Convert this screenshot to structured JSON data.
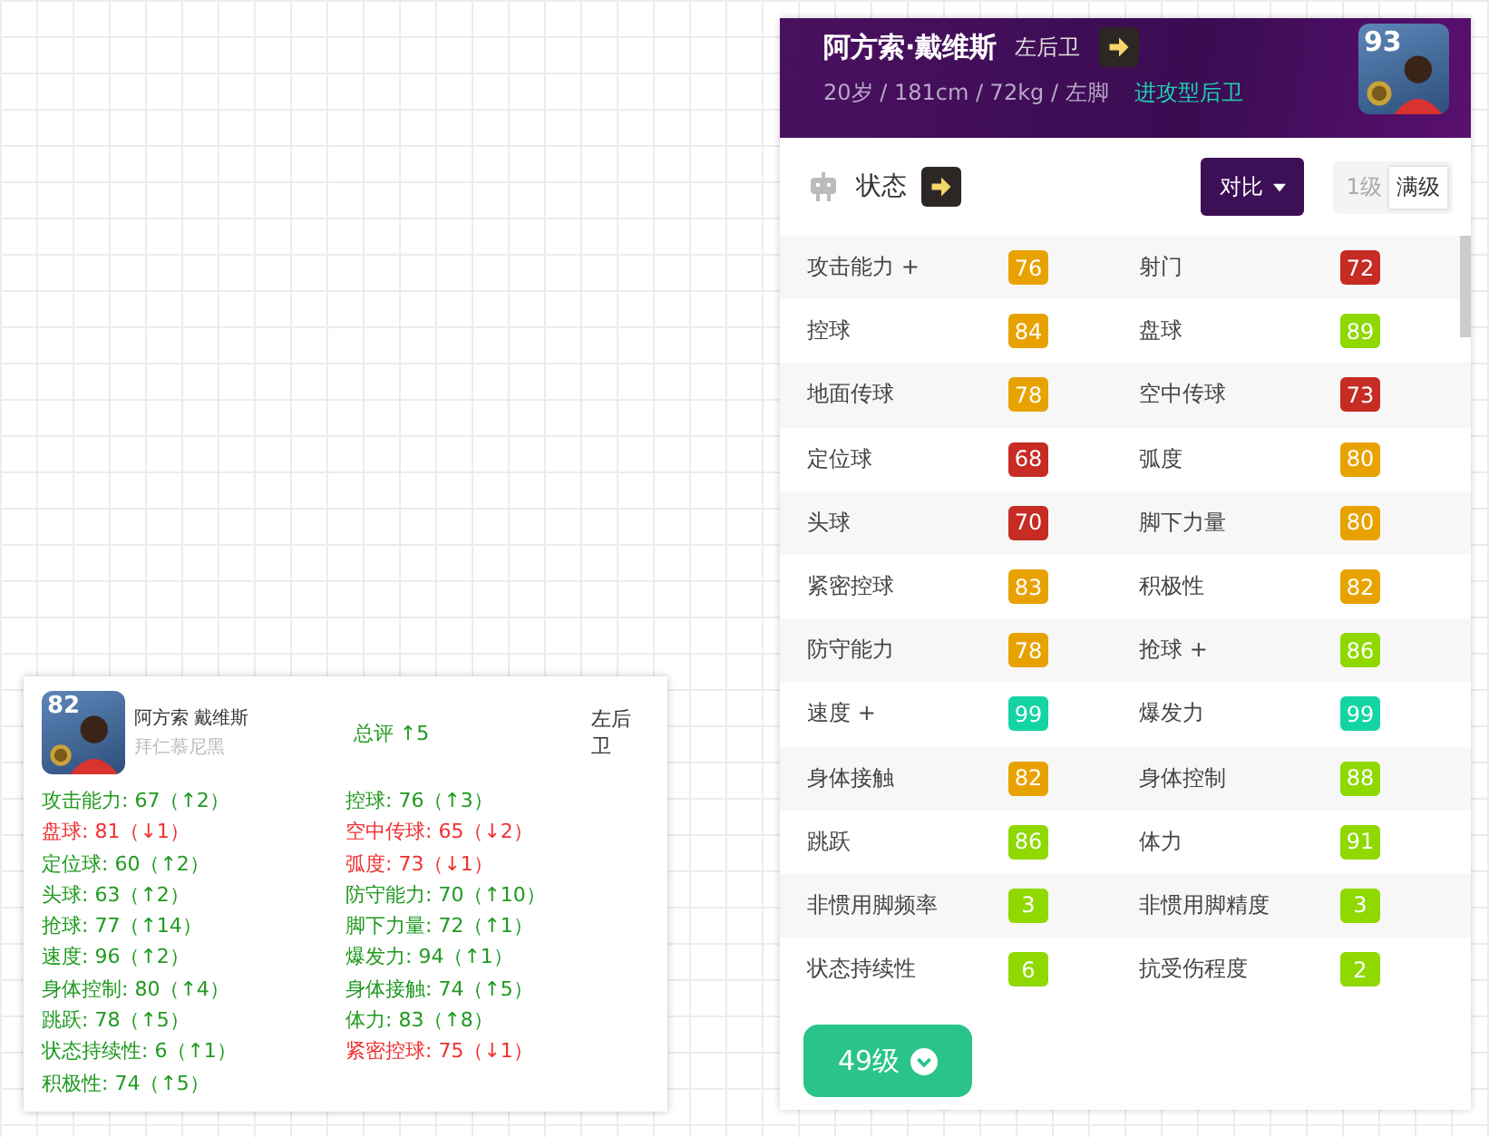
{
  "player_panel": {
    "name": "阿方索·戴维斯",
    "position": "左后卫",
    "rating": "93",
    "bio": "20岁 / 181cm / 72kg / 左脚",
    "role": "进攻型后卫",
    "section_title": "状态",
    "compare_button": "对比",
    "levels": [
      {
        "label": "1级",
        "selected": false
      },
      {
        "label": "满级",
        "selected": true
      }
    ],
    "stats": [
      {
        "label": "攻击能力 +",
        "value": "76",
        "color": "#e8a200"
      },
      {
        "label": "射门",
        "value": "72",
        "color": "#c62b24"
      },
      {
        "label": "控球",
        "value": "84",
        "color": "#e8a200"
      },
      {
        "label": "盘球",
        "value": "89",
        "color": "#8fd800"
      },
      {
        "label": "地面传球",
        "value": "78",
        "color": "#e8a200"
      },
      {
        "label": "空中传球",
        "value": "73",
        "color": "#c62b24"
      },
      {
        "label": "定位球",
        "value": "68",
        "color": "#c62b24"
      },
      {
        "label": "弧度",
        "value": "80",
        "color": "#e8a200"
      },
      {
        "label": "头球",
        "value": "70",
        "color": "#c62b24"
      },
      {
        "label": "脚下力量",
        "value": "80",
        "color": "#e8a200"
      },
      {
        "label": "紧密控球",
        "value": "83",
        "color": "#e8a200"
      },
      {
        "label": "积极性",
        "value": "82",
        "color": "#e8a200"
      },
      {
        "label": "防守能力",
        "value": "78",
        "color": "#e8a200"
      },
      {
        "label": "抢球 +",
        "value": "86",
        "color": "#8fd800"
      },
      {
        "label": "速度 +",
        "value": "99",
        "color": "#14d4a4"
      },
      {
        "label": "爆发力",
        "value": "99",
        "color": "#14d4a4"
      },
      {
        "label": "身体接触",
        "value": "82",
        "color": "#e8a200"
      },
      {
        "label": "身体控制",
        "value": "88",
        "color": "#8fd800"
      },
      {
        "label": "跳跃",
        "value": "86",
        "color": "#8fd800"
      },
      {
        "label": "体力",
        "value": "91",
        "color": "#8fd800"
      },
      {
        "label": "非惯用脚频率",
        "value": "3",
        "color": "#8fd800"
      },
      {
        "label": "非惯用脚精度",
        "value": "3",
        "color": "#8fd800"
      },
      {
        "label": "状态持续性",
        "value": "6",
        "color": "#8fd800"
      },
      {
        "label": "抗受伤程度",
        "value": "2",
        "color": "#8fd800"
      }
    ],
    "level_button": "49级"
  },
  "compare_card": {
    "rating": "82",
    "name": "阿方索 戴维斯",
    "club": "拜仁慕尼黑",
    "overall": "总评 ↑5",
    "position": "左后卫",
    "left_changes": [
      {
        "text": "攻击能力: 67（↑2）",
        "kind": "up"
      },
      {
        "text": "盘球: 81（↓1）",
        "kind": "down"
      },
      {
        "text": "定位球: 60（↑2）",
        "kind": "up"
      },
      {
        "text": "头球: 63（↑2）",
        "kind": "up"
      },
      {
        "text": "抢球: 77（↑14）",
        "kind": "up"
      },
      {
        "text": "速度: 96（↑2）",
        "kind": "up"
      },
      {
        "text": "身体控制: 80（↑4）",
        "kind": "up"
      },
      {
        "text": "跳跃: 78（↑5）",
        "kind": "up"
      },
      {
        "text": "状态持续性: 6（↑1）",
        "kind": "up"
      },
      {
        "text": "积极性: 74（↑5）",
        "kind": "up"
      }
    ],
    "right_changes": [
      {
        "text": "控球: 76（↑3）",
        "kind": "up"
      },
      {
        "text": "空中传球: 65（↓2）",
        "kind": "down"
      },
      {
        "text": "弧度: 73（↓1）",
        "kind": "down"
      },
      {
        "text": "防守能力: 70（↑10）",
        "kind": "up"
      },
      {
        "text": "脚下力量: 72（↑1）",
        "kind": "up"
      },
      {
        "text": "爆发力: 94（↑1）",
        "kind": "up"
      },
      {
        "text": "身体接触: 74（↑5）",
        "kind": "up"
      },
      {
        "text": "体力: 83（↑8）",
        "kind": "up"
      },
      {
        "text": "紧密控球: 75（↓1）",
        "kind": "down"
      }
    ]
  }
}
